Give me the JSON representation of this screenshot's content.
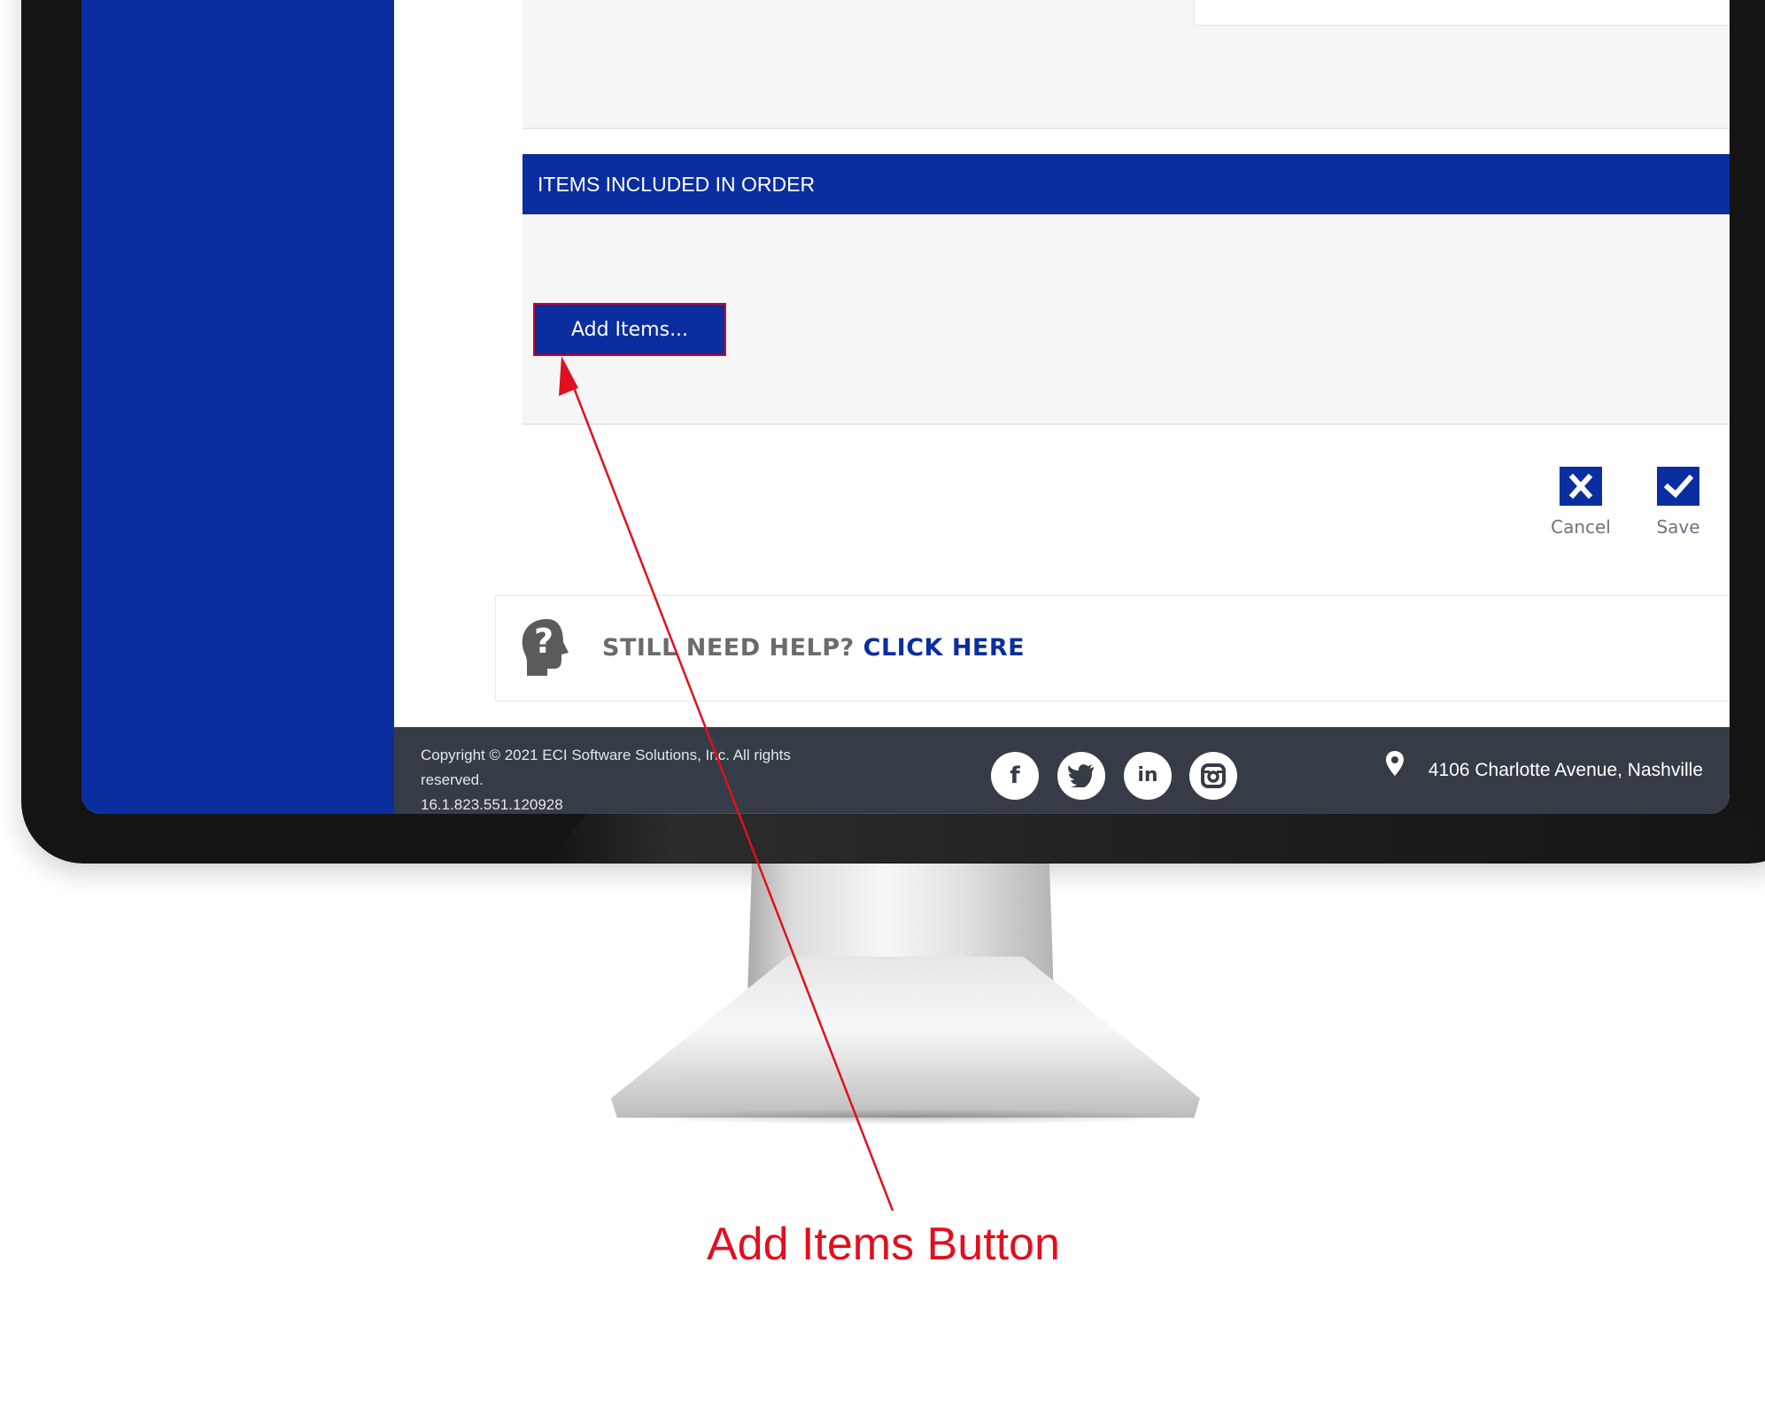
{
  "section": {
    "title": "ITEMS INCLUDED IN ORDER",
    "add_items_label": "Add Items..."
  },
  "actions": {
    "cancel_label": "Cancel",
    "save_label": "Save"
  },
  "help": {
    "prompt": "STILL NEED HELP?",
    "link": "CLICK HERE"
  },
  "footer": {
    "copyright_line1": "Copyright © 2021 ECI Software Solutions, Inc. All rights",
    "copyright_line2": "reserved.",
    "version": "16.1.823.551.120928",
    "social": [
      "facebook-icon",
      "twitter-icon",
      "linkedin-icon",
      "instagram-icon"
    ],
    "address": "4106 Charlotte Avenue, Nashville"
  },
  "annotation": {
    "label": "Add Items Button"
  },
  "colors": {
    "brand_blue": "#0a2ea0",
    "footer_bg": "#363c45",
    "annotation_red": "#e10f1f"
  }
}
